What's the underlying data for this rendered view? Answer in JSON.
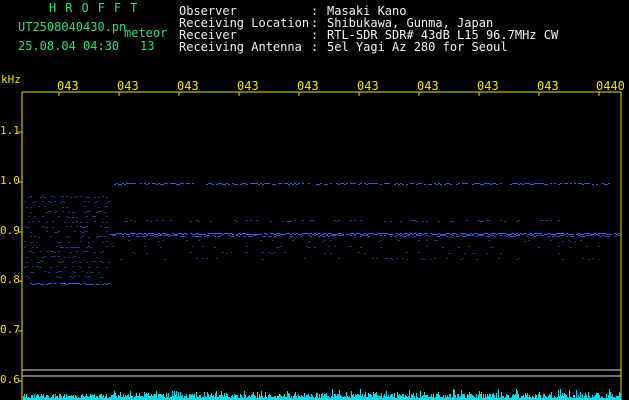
{
  "header": {
    "brand": "HROFFT",
    "filename": "UT2508040430.pn",
    "tag": "meteor",
    "datetime": "25.08.04 04:30",
    "count": "13"
  },
  "info": {
    "rows": [
      {
        "label": "Observer",
        "value": "Masaki Kano"
      },
      {
        "label": "Receiving Location",
        "value": "Shibukawa, Gunma, Japan"
      },
      {
        "label": "Receiver",
        "value": "RTL-SDR SDR# 43dB L15 96.7MHz CW"
      },
      {
        "label": "Receiving Antenna",
        "value": "5el Yagi Az 280 for Seoul"
      }
    ],
    "separator": ":"
  },
  "axis": {
    "y_unit": "kHz",
    "y_ticks": [
      "1.1",
      "1.0",
      "0.9",
      "0.8",
      "0.7",
      "0.6"
    ],
    "x_ticks": [
      "043",
      "043",
      "043",
      "043",
      "043",
      "043",
      "043",
      "043",
      "043",
      "0440"
    ]
  },
  "colors": {
    "header_text": "#27e07a",
    "info_text": "#f2f2f2",
    "tick_text": "#f0e000",
    "echo": "#3a5cff",
    "spectrum": "#19d6e0"
  }
}
